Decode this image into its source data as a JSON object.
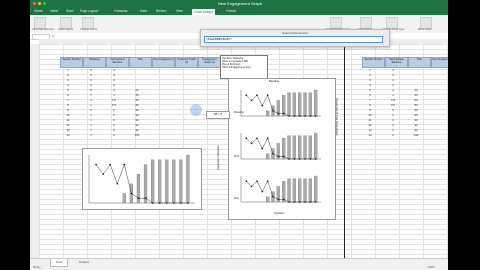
{
  "window": {
    "title": "New Engagement Graph"
  },
  "ribbon_tabs": [
    "Home",
    "Insert",
    "Draw",
    "Page Layout",
    "Formulas",
    "Data",
    "Review",
    "View",
    "Chart Design",
    "Format"
  ],
  "ribbon_buttons": [
    "Add Chart Element",
    "Quick Layout",
    "Change Colors",
    "Switch Row/Column",
    "Select Data",
    "Change Chart Type",
    "Move Chart"
  ],
  "formula_bar": {
    "name_box": "",
    "fx": "fx"
  },
  "select_dialog": {
    "title": "Select Data Source",
    "range": "=Data!$B$3:$G$77"
  },
  "left_table": {
    "headers": [
      "Session Number",
      "Modeling",
      "Self-Injurious Behavior",
      "Play",
      "Peer Engagement",
      "Treatment Graph (1)",
      "Engagement Graph (2)"
    ],
    "rows": [
      [
        "1",
        "0",
        "4",
        "",
        ""
      ],
      [
        "2",
        "0",
        "3",
        "",
        ""
      ],
      [
        "3",
        "0",
        "4",
        "",
        ""
      ],
      [
        "4",
        "0",
        "2",
        "",
        ""
      ],
      [
        "5",
        "0",
        "4",
        "20",
        ""
      ],
      [
        "6",
        "1",
        "1",
        "40",
        ""
      ],
      [
        "7",
        "1",
        "0.5",
        "60",
        ""
      ],
      [
        "8",
        "1",
        "0.5",
        "80",
        ""
      ],
      [
        "9",
        "1",
        "0",
        "90",
        ""
      ],
      [
        "10",
        "1",
        "0",
        "90",
        ""
      ],
      [
        "11",
        "1",
        "0",
        "90",
        ""
      ],
      [
        "12",
        "1",
        "0",
        "90",
        ""
      ],
      [
        "13",
        "1",
        "0",
        "90",
        ""
      ],
      [
        "14",
        "1",
        "0",
        "100",
        ""
      ]
    ]
  },
  "right_table": {
    "headers": [
      "Session Number",
      "Self-Injurious Behavior",
      "Play",
      "Peer Engagement",
      "Treatment Graph (1)"
    ],
    "rows": [
      [
        "1",
        "4",
        "",
        ""
      ],
      [
        "2",
        "3",
        "",
        ""
      ],
      [
        "3",
        "4",
        "",
        ""
      ],
      [
        "4",
        "2",
        "",
        ""
      ],
      [
        "5",
        "4",
        "20",
        ""
      ],
      [
        "6",
        "1",
        "40",
        ""
      ],
      [
        "7",
        "0.5",
        "60",
        ""
      ],
      [
        "8",
        "0.5",
        "80",
        ""
      ],
      [
        "9",
        "0",
        "90",
        ""
      ],
      [
        "10",
        "0",
        "90",
        ""
      ],
      [
        "11",
        "0",
        "90",
        ""
      ],
      [
        "12",
        "0",
        "90",
        ""
      ],
      [
        "13",
        "0",
        "90",
        ""
      ],
      [
        "14",
        "0",
        "100",
        ""
      ]
    ]
  },
  "legend_box": [
    "Top Row: Modeling",
    "Rows 2-3 graphed: SIB",
    "Play & Summary",
    "Other's Engagement Sum"
  ],
  "chart_panels": {
    "panel1_title": "Baseline",
    "panel1_label": "Modeling",
    "panel2_label": "Prob.",
    "panel3_label": "Peer",
    "y_axis": "Dependent Measures",
    "y2_axis": "Percentage of Peer Engagement",
    "x_axis": "Sessions"
  },
  "tooltip": "B6 × 8",
  "sheets": [
    "Data",
    "Graphs"
  ],
  "status": {
    "left": "Ready",
    "zoom": "100%"
  },
  "chart_data": [
    {
      "type": "bar",
      "x": [
        5,
        6,
        7,
        8,
        9,
        10,
        11,
        12,
        13,
        14
      ],
      "values": [
        20,
        40,
        60,
        80,
        90,
        90,
        90,
        90,
        90,
        100
      ],
      "series_line": {
        "x": [
          1,
          2,
          3,
          4,
          5,
          6,
          7,
          8,
          9,
          10,
          11,
          12,
          13,
          14
        ],
        "y": [
          4,
          3,
          4,
          2,
          4,
          1,
          0.5,
          0.5,
          0,
          0,
          0,
          0,
          0,
          0
        ]
      },
      "ylim": [
        0,
        100
      ]
    }
  ],
  "colors": {
    "brand": "#1f7244",
    "header_fill": "#b8cde4"
  }
}
